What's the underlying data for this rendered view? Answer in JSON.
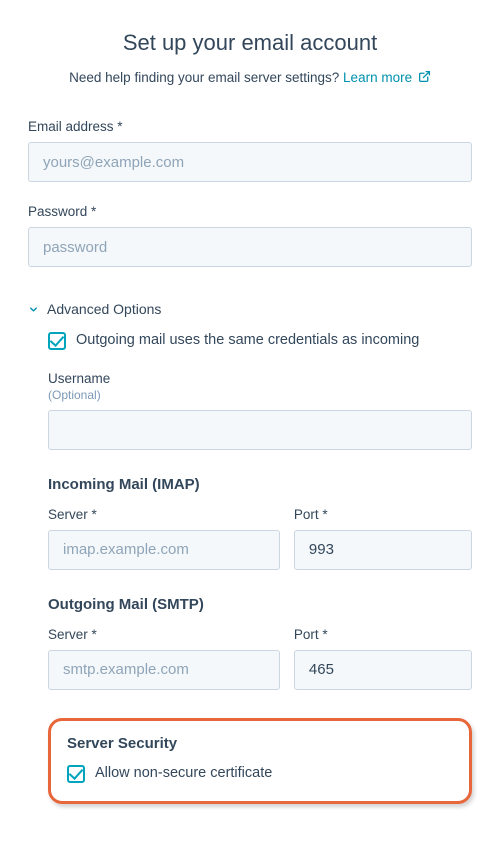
{
  "title": "Set up your email account",
  "help": {
    "prefix": "Need help finding your email server settings? ",
    "link_label": "Learn more"
  },
  "email": {
    "label": "Email address *",
    "placeholder": "yours@example.com",
    "value": ""
  },
  "password": {
    "label": "Password *",
    "placeholder": "password",
    "value": ""
  },
  "advanced": {
    "toggle_label": "Advanced Options",
    "same_credentials_label": "Outgoing mail uses the same credentials as incoming",
    "same_credentials_checked": true,
    "username": {
      "label": "Username",
      "optional_label": "(Optional)",
      "value": ""
    }
  },
  "incoming": {
    "heading": "Incoming Mail (IMAP)",
    "server_label": "Server *",
    "server_placeholder": "imap.example.com",
    "server_value": "",
    "port_label": "Port *",
    "port_value": "993"
  },
  "outgoing": {
    "heading": "Outgoing Mail (SMTP)",
    "server_label": "Server *",
    "server_placeholder": "smtp.example.com",
    "server_value": "",
    "port_label": "Port *",
    "port_value": "465"
  },
  "security": {
    "heading": "Server Security",
    "allow_nonsecure_label": "Allow non-secure certificate",
    "allow_nonsecure_checked": true
  }
}
